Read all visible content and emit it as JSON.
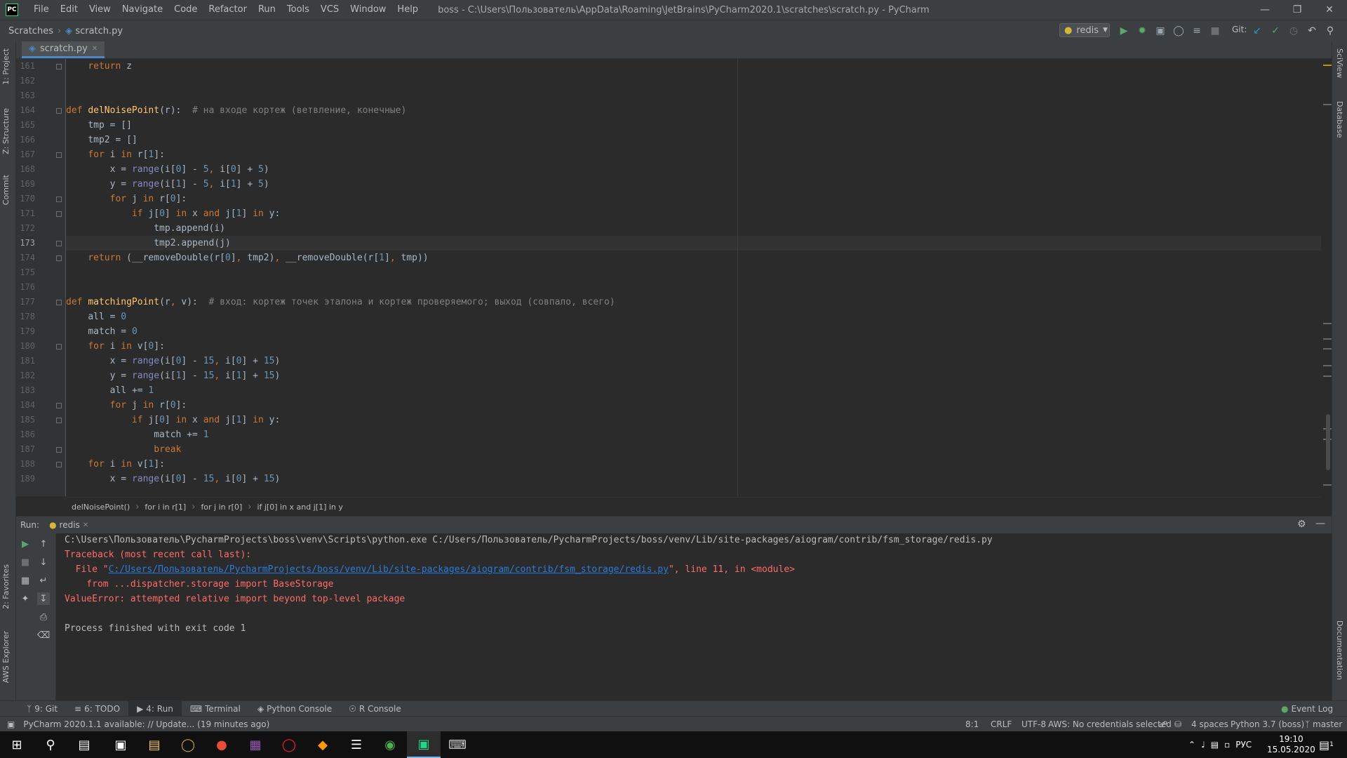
{
  "titlebar": {
    "app_icon": "PC",
    "menu": [
      "File",
      "Edit",
      "View",
      "Navigate",
      "Code",
      "Refactor",
      "Run",
      "Tools",
      "VCS",
      "Window",
      "Help"
    ],
    "title": "boss - C:\\Users\\Пользователь\\AppData\\Roaming\\JetBrains\\PyCharm2020.1\\scratches\\scratch.py - PyCharm"
  },
  "navbar": {
    "breadcrumbs": [
      "Scratches",
      "scratch.py"
    ],
    "run_config": "redis",
    "git_label": "Git:"
  },
  "left_tools": [
    "1: Project",
    "Z: Structure",
    "Commit",
    "2: Favorites",
    "AWS Explorer"
  ],
  "right_tools": [
    "SciView",
    "Database",
    "Documentation"
  ],
  "editor_tab": "scratch.py",
  "current_line": "173",
  "line_numbers": [
    "161",
    "162",
    "163",
    "164",
    "165",
    "166",
    "167",
    "168",
    "169",
    "170",
    "171",
    "172",
    "173",
    "174",
    "175",
    "176",
    "177",
    "178",
    "179",
    "180",
    "181",
    "182",
    "183",
    "184",
    "185",
    "186",
    "187",
    "188",
    "189"
  ],
  "code_lines": [
    "    return z",
    "",
    "",
    "def delNoisePoint(r):  # на входе кортеж (ветвление, конечные)",
    "    tmp = []",
    "    tmp2 = []",
    "    for i in r[1]:",
    "        x = range(i[0] - 5, i[0] + 5)",
    "        y = range(i[1] - 5, i[1] + 5)",
    "        for j in r[0]:",
    "            if j[0] in x and j[1] in y:",
    "                tmp.append(i)",
    "                tmp2.append(j)",
    "    return (__removeDouble(r[0], tmp2), __removeDouble(r[1], tmp))",
    "",
    "",
    "def matchingPoint(r, v):  # вход: кортеж точек эталона и кортеж проверяемого; выход (совпало, всего)",
    "    all = 0",
    "    match = 0",
    "    for i in v[0]:",
    "        x = range(i[0] - 15, i[0] + 15)",
    "        y = range(i[1] - 15, i[1] + 15)",
    "        all += 1",
    "        for j in r[0]:",
    "            if j[0] in x and j[1] in y:",
    "                match += 1",
    "                break",
    "    for i in v[1]:",
    "        x = range(i[0] - 15, i[0] + 15)"
  ],
  "editor_breadcrumb": [
    "delNoisePoint()",
    "for i in r[1]",
    "for j in r[0]",
    "if j[0] in x and j[1] in y"
  ],
  "run_panel": {
    "label": "Run:",
    "tab": "redis",
    "console": {
      "cmd": "C:\\Users\\Пользователь\\PycharmProjects\\boss\\venv\\Scripts\\python.exe C:/Users/Пользователь/PycharmProjects/boss/venv/Lib/site-packages/aiogram/contrib/fsm_storage/redis.py",
      "traceback": "Traceback (most recent call last):",
      "file_prefix": "  File \"",
      "file_link": "C:/Users/Пользователь/PycharmProjects/boss/venv/Lib/site-packages/aiogram/contrib/fsm_storage/redis.py",
      "file_suffix": "\", line 11, in <module>",
      "from_line": "    from ...dispatcher.storage import BaseStorage",
      "error": "ValueError: attempted relative import beyond top-level package",
      "exit": "Process finished with exit code 1"
    }
  },
  "tool_tabs": [
    "9: Git",
    "6: TODO",
    "4: Run",
    "Terminal",
    "Python Console",
    "R Console"
  ],
  "event_log": "Event Log",
  "status": {
    "update": "PyCharm 2020.1.1 available: // Update... (19 minutes ago)",
    "position": "8:1",
    "line_sep": "CRLF",
    "encoding": "UTF-8",
    "aws": "AWS: No credentials selected",
    "indent": "4 spaces",
    "interpreter": "Python 3.7 (boss)",
    "branch": "master"
  },
  "taskbar": {
    "lang": "РУС",
    "time": "19:10",
    "date": "15.05.2020",
    "notifications": "1"
  },
  "colors": {
    "keyword": "#cc7832",
    "number": "#6897bb",
    "comment": "#808080",
    "function": "#ffc66d",
    "error": "#ff6b68",
    "link": "#287bde"
  }
}
